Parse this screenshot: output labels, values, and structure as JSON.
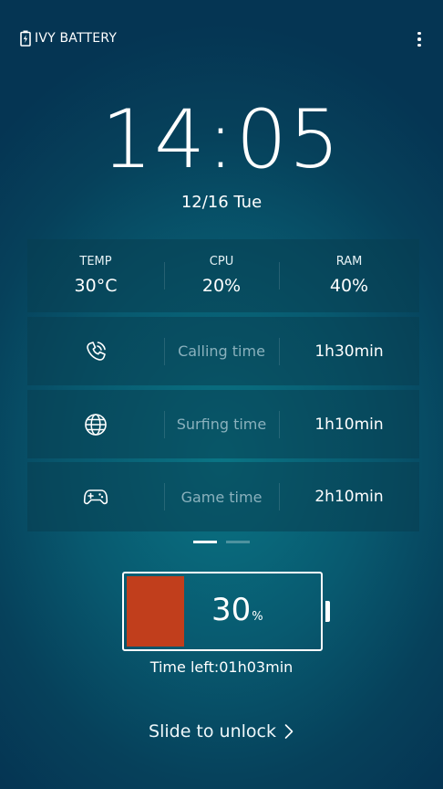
{
  "app": {
    "title": "IVY BATTERY",
    "logo_icon": "battery-charging-icon",
    "menu_icon": "more-vert-icon"
  },
  "clock": {
    "time": "14:05",
    "date": "12/16 Tue"
  },
  "stats": {
    "temp": {
      "label": "TEMP",
      "value": "30°C"
    },
    "cpu": {
      "label": "CPU",
      "value": "20%"
    },
    "ram": {
      "label": "RAM",
      "value": "40%"
    }
  },
  "usage": [
    {
      "icon": "phone-call-icon",
      "label": "Calling time",
      "value": "1h30min"
    },
    {
      "icon": "globe-icon",
      "label": "Surfing time",
      "value": "1h10min"
    },
    {
      "icon": "gamepad-icon",
      "label": "Game time",
      "value": "2h10min"
    }
  ],
  "pager": {
    "pages": 2,
    "active": 0
  },
  "battery": {
    "level": 30,
    "percent_text": "30",
    "unit": "%",
    "fill_color": "#c13e1c",
    "time_left_label": "Time left:",
    "time_left_value": "01h03min"
  },
  "unlock": {
    "label": "Slide to unlock",
    "icon": "chevron-right-icon"
  },
  "colors": {
    "background": "#07546a",
    "card": "#073e50",
    "accent_red": "#c13e1c",
    "muted_text": "#8ab1bd"
  }
}
